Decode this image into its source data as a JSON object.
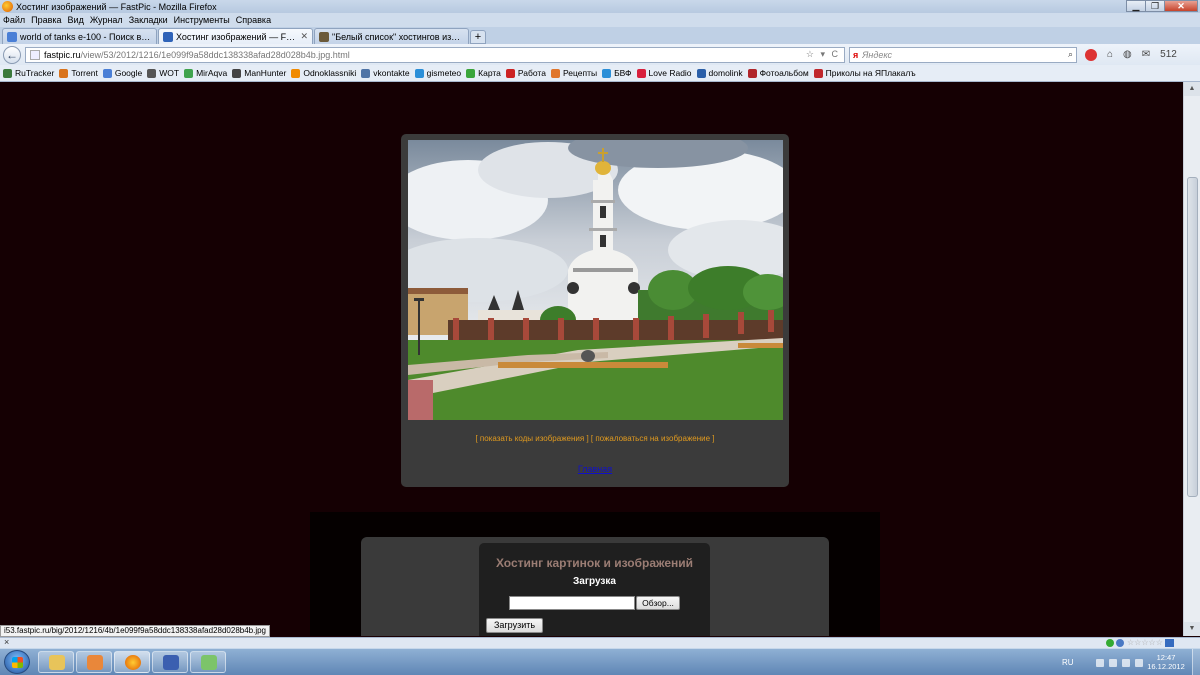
{
  "window": {
    "title": "Хостинг изображений — FastPic - Mozilla Firefox",
    "controls": {
      "minimize": "▁",
      "maximize": "❐",
      "close": "✕"
    }
  },
  "menu": [
    "Файл",
    "Правка",
    "Вид",
    "Журнал",
    "Закладки",
    "Инструменты",
    "Справка"
  ],
  "tabs": [
    {
      "label": "world of tanks e-100 - Поиск в Google",
      "active": false,
      "icon_color": "#4a7fd6"
    },
    {
      "label": "Хостинг изображений — FastPic",
      "active": true,
      "icon_color": "#2f63b8"
    },
    {
      "label": "\"Белый список\" хостингов изображ...",
      "active": false,
      "icon_color": "#6b5a3a"
    }
  ],
  "new_tab_label": "+",
  "nav": {
    "back": "←",
    "url_domain": "fastpic.ru",
    "url_path": "/view/53/2012/1216/1e099f9a58ddc138338afad28d028b4b.jpg.html",
    "url_end": "☆ ▾ C",
    "search_engine": "я",
    "search_placeholder": "Яндекс",
    "search_icon": "⌕",
    "home_icon": "⌂",
    "badge_count": "512"
  },
  "bookmarks": [
    {
      "label": "RuTracker",
      "color": "#3c7a3c"
    },
    {
      "label": "Torrent",
      "color": "#d9731c"
    },
    {
      "label": "Google",
      "color": "#4a7fd6"
    },
    {
      "label": "WOT",
      "color": "#555555"
    },
    {
      "label": "MirAqva",
      "color": "#3fa34d"
    },
    {
      "label": "ManHunter",
      "color": "#444444"
    },
    {
      "label": "Odnoklassniki",
      "color": "#f08a00"
    },
    {
      "label": "vkontakte",
      "color": "#4f74a6"
    },
    {
      "label": "gismeteo",
      "color": "#2b8fd8"
    },
    {
      "label": "Карта",
      "color": "#3aa53a"
    },
    {
      "label": "Работа",
      "color": "#cc2222"
    },
    {
      "label": "Рецепты",
      "color": "#e0762c"
    },
    {
      "label": "БВФ",
      "color": "#2b8fd8"
    },
    {
      "label": "Love Radio",
      "color": "#d8203c"
    },
    {
      "label": "domolink",
      "color": "#2b5fa8"
    },
    {
      "label": "Фотоальбом",
      "color": "#b0252a"
    },
    {
      "label": "Приколы на ЯПлакалъ",
      "color": "#c0282d"
    }
  ],
  "page": {
    "image_links": {
      "codes": "[ показать коды изображения ]",
      "complain": "[ пожаловаться на изображение ]"
    },
    "home_link": "Главная",
    "hosting_title": "Хостинг картинок и изображений",
    "upload_heading": "Загрузка",
    "file_input_value": "",
    "browse_label": "Обзор...",
    "submit_label": "Загрузить"
  },
  "status_url": "i53.fastpic.ru/big/2012/1216/4b/1e099f9a58ddc138338afad28d028b4b.jpg",
  "addon_bar": {
    "close_label": "×",
    "stars": "☆☆☆☆☆"
  },
  "taskbar": {
    "apps": [
      {
        "name": "explorer",
        "color": "#e8c45a"
      },
      {
        "name": "media",
        "color": "#e9873a"
      },
      {
        "name": "firefox",
        "color": "#e05a00"
      },
      {
        "name": "save",
        "color": "#3b5fb0"
      },
      {
        "name": "notes",
        "color": "#7cc46a"
      }
    ],
    "language": "RU",
    "time": "12:47",
    "date": "16.12.2012"
  },
  "colors": {
    "page_bg": "#150003",
    "link_orange": "#e09a1f",
    "home_link_blue": "#1010c8",
    "title_mauve": "#9b7d74"
  }
}
